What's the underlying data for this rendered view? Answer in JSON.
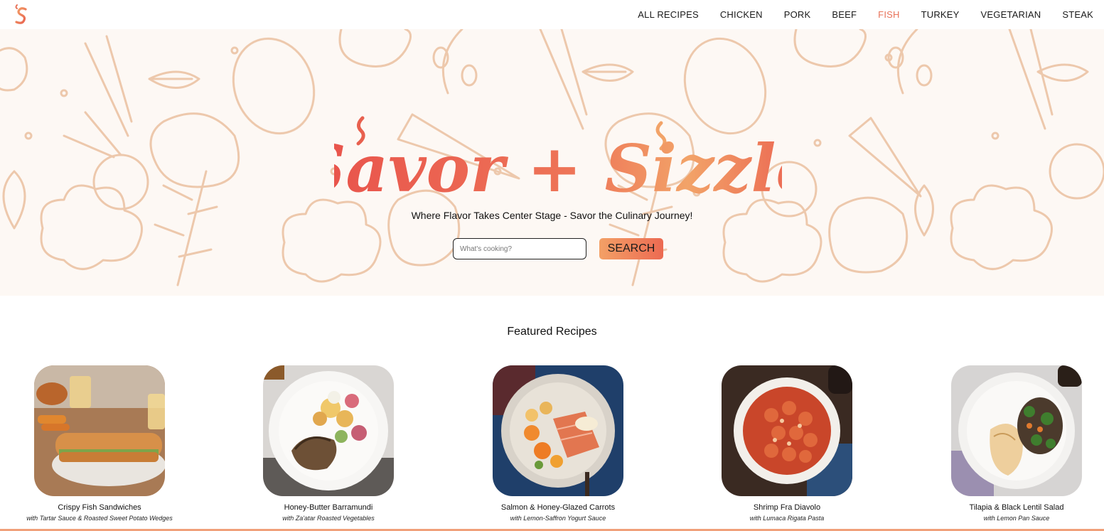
{
  "nav": {
    "items": [
      {
        "label": "ALL RECIPES",
        "active": false
      },
      {
        "label": "CHICKEN",
        "active": false
      },
      {
        "label": "PORK",
        "active": false
      },
      {
        "label": "BEEF",
        "active": false
      },
      {
        "label": "FISH",
        "active": true
      },
      {
        "label": "TURKEY",
        "active": false
      },
      {
        "label": "VEGETARIAN",
        "active": false
      },
      {
        "label": "STEAK",
        "active": false
      }
    ]
  },
  "hero": {
    "title": "Savor + Sizzle",
    "tagline": "Where Flavor Takes Center Stage - Savor the Culinary Journey!",
    "search_placeholder": "What's cooking?",
    "search_value": "",
    "search_button": "SEARCH"
  },
  "featured": {
    "title": "Featured Recipes",
    "recipes": [
      {
        "name": "Crispy Fish Sandwiches",
        "sub": "with Tartar Sauce & Roasted Sweet Potato Wedges"
      },
      {
        "name": "Honey-Butter Barramundi",
        "sub": "with Za'atar Roasted Vegetables"
      },
      {
        "name": "Salmon & Honey-Glazed Carrots",
        "sub": "with Lemon-Saffron Yogurt Sauce"
      },
      {
        "name": "Shrimp Fra Diavolo",
        "sub": "with Lumaca Rigata Pasta"
      },
      {
        "name": "Tilapia & Black Lentil Salad",
        "sub": "with Lemon Pan Sauce"
      }
    ]
  },
  "colors": {
    "accent": "#e8735a",
    "gradient_start": "#f3a066",
    "gradient_end": "#ec6a52",
    "pattern_stroke": "#ecc6a8"
  }
}
